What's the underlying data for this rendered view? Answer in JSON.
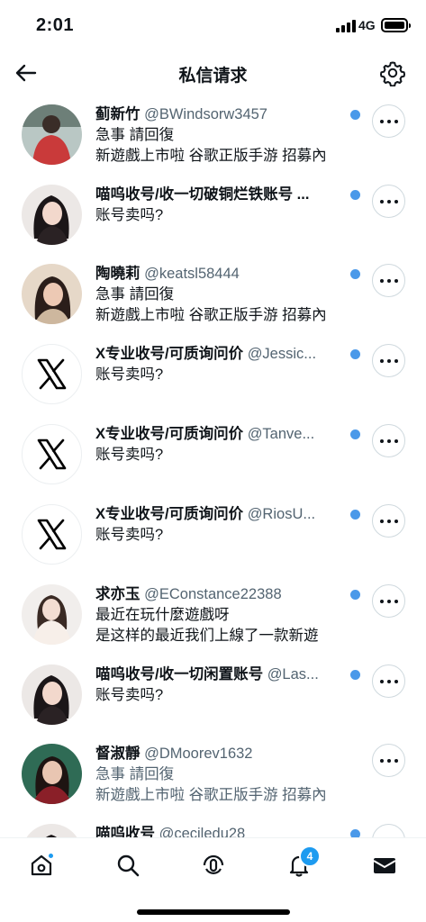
{
  "status_bar": {
    "time": "2:01",
    "network": "4G",
    "battery_level": 0.85
  },
  "header": {
    "title": "私信请求",
    "back_icon": "arrow-left-icon",
    "settings_icon": "gear-icon"
  },
  "requests": [
    {
      "name": "蓟新竹",
      "handle": "@BWindsorw3457",
      "line1": "急事  請回復",
      "line2": "新遊戲上市啦 谷歌正版手游 招募內",
      "avatar": "photo",
      "unread": true,
      "dimmed": false
    },
    {
      "name": "喵呜收号/收一切破铜烂铁账号 ...",
      "handle": "",
      "line1": "账号卖吗?",
      "line2": "",
      "avatar": "photo",
      "unread": true,
      "dimmed": false
    },
    {
      "name": "陶曉莉",
      "handle": "@keatsl58444",
      "line1": "急事  請回復",
      "line2": "新遊戲上市啦 谷歌正版手游 招募內",
      "avatar": "photo",
      "unread": true,
      "dimmed": false
    },
    {
      "name": "X专业收号/可质询问价",
      "handle": "@Jessic...",
      "line1": "账号卖吗?",
      "line2": "",
      "avatar": "x-logo",
      "unread": true,
      "dimmed": false
    },
    {
      "name": "X专业收号/可质询问价",
      "handle": "@Tanve...",
      "line1": "账号卖吗?",
      "line2": "",
      "avatar": "x-logo",
      "unread": true,
      "dimmed": false
    },
    {
      "name": "X专业收号/可质询问价",
      "handle": "@RiosU...",
      "line1": "账号卖吗?",
      "line2": "",
      "avatar": "x-logo",
      "unread": true,
      "dimmed": false
    },
    {
      "name": "求亦玉",
      "handle": "@EConstance22388",
      "line1": "最近在玩什麼遊戲呀",
      "line2": "是这样的最近我们上線了一款新遊",
      "avatar": "photo",
      "unread": true,
      "dimmed": false
    },
    {
      "name": "喵呜收号/收一切闲置账号",
      "handle": "@Las...",
      "line1": "账号卖吗?",
      "line2": "",
      "avatar": "photo",
      "unread": true,
      "dimmed": false
    },
    {
      "name": "督淑靜",
      "handle": "@DMoorev1632",
      "line1": "急事  請回復",
      "line2": "新遊戲上市啦 谷歌正版手游 招募內",
      "avatar": "photo",
      "unread": false,
      "dimmed": true
    },
    {
      "name": "喵呜收号",
      "handle": "@ceciledu28",
      "line1": "",
      "line2": "",
      "avatar": "photo",
      "unread": true,
      "dimmed": false
    }
  ],
  "tabbar": {
    "home_icon": "home-icon",
    "search_icon": "search-icon",
    "spaces_icon": "spaces-icon",
    "notifications_icon": "bell-icon",
    "notifications_count": "4",
    "messages_icon": "envelope-icon"
  },
  "colors": {
    "accent": "#1d9bf0",
    "unread_dot": "#4a99e9",
    "secondary_text": "#536471"
  }
}
